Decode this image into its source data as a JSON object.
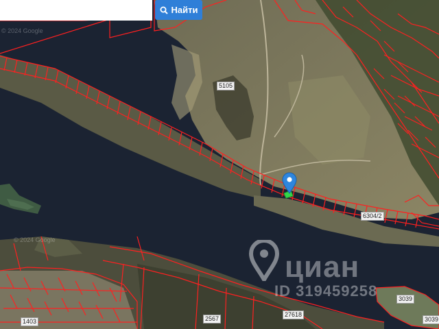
{
  "search": {
    "placeholder": "",
    "value": "",
    "button_label": "Найти"
  },
  "parcel_labels": {
    "p5105": "5105",
    "p6304": "6304/2",
    "p1403": "1403",
    "p2567": "2567",
    "p27618": "27618",
    "p3039a": "3039",
    "p3039b": "3039"
  },
  "copyright": {
    "top": "© 2024 Google",
    "bottom": "© 2024 Google"
  },
  "watermark": {
    "brand": "циан",
    "id": "ID 319459258"
  },
  "colors": {
    "parcel_border": "#ff2020",
    "search_button": "#2f7fd8",
    "marker": "#2e86de",
    "water": "#1b2332"
  },
  "icons": {
    "search_button_icon": "magnifier",
    "location_marker": "map-pin",
    "selected_parcel": "green-parcel"
  }
}
